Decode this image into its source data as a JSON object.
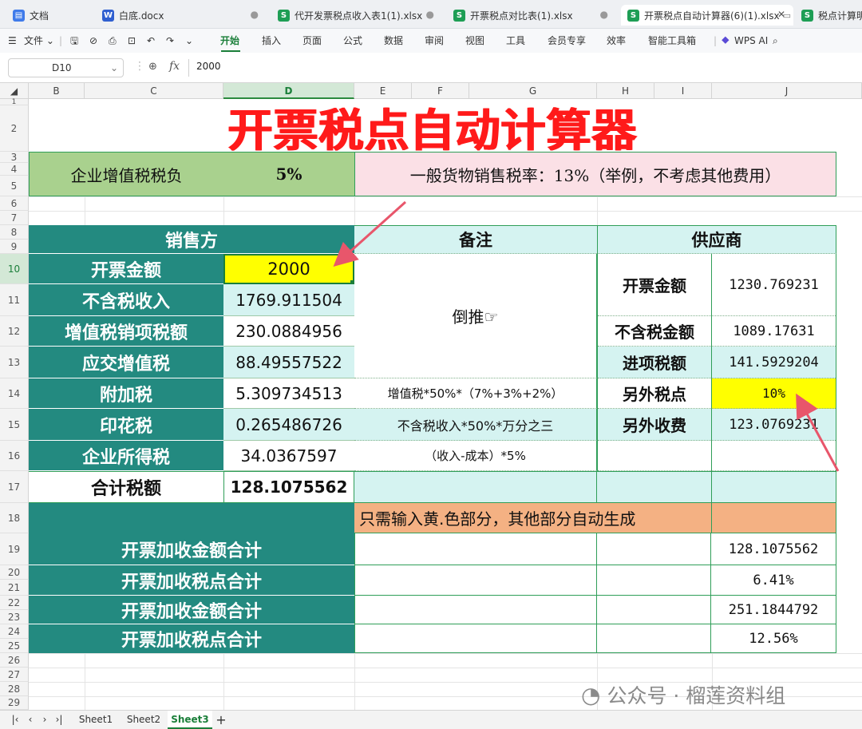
{
  "tabs": [
    {
      "label": "文档",
      "icon": "doc-home-icon",
      "badge": ""
    },
    {
      "label": "白底.docx",
      "icon": "word-icon",
      "badge": "W"
    },
    {
      "label": "代开发票税点收入表1(1).xlsx",
      "icon": "sheet-icon",
      "badge": "S"
    },
    {
      "label": "开票税点对比表(1).xlsx",
      "icon": "sheet-icon",
      "badge": "S"
    },
    {
      "label": "开票税点自动计算器(6)(1).xlsx",
      "icon": "sheet-icon",
      "badge": "S"
    },
    {
      "label": "税点计算明细",
      "icon": "sheet-icon",
      "badge": "S"
    }
  ],
  "menu": {
    "file": "文件",
    "items": [
      "开始",
      "插入",
      "页面",
      "公式",
      "数据",
      "审阅",
      "视图",
      "工具",
      "会员专享",
      "效率",
      "智能工具箱"
    ],
    "active": "开始",
    "wps_ai": "WPS AI"
  },
  "formula_bar": {
    "cell_ref": "D10",
    "fx": "fx",
    "content": "2000"
  },
  "columns": [
    "B",
    "C",
    "D",
    "E",
    "F",
    "G",
    "H",
    "I",
    "J"
  ],
  "selected_column": "D",
  "rows": [
    "1",
    "2",
    "3",
    "4",
    "5",
    "6",
    "7",
    "8",
    "9",
    "10",
    "11",
    "12",
    "13",
    "14",
    "15",
    "16",
    "17",
    "18",
    "19",
    "20",
    "21",
    "22",
    "23",
    "24",
    "25",
    "26",
    "27",
    "28",
    "29"
  ],
  "sheet": {
    "title": "开票税点自动计算器",
    "burden_label": "企业增值税税负",
    "burden_value": "5%",
    "rate_note": "一般货物销售税率：13%（举例，不考虑其他费用）",
    "seller_header": "销售方",
    "remark_header": "备注",
    "supplier_header": "供应商",
    "seller_rows": [
      {
        "label": "开票金额",
        "value": "2000"
      },
      {
        "label": "不含税收入",
        "value": "1769.911504"
      },
      {
        "label": "增值税销项税额",
        "value": "230.0884956"
      },
      {
        "label": "应交增值税",
        "value": "88.49557522"
      },
      {
        "label": "附加税",
        "value": "5.309734513"
      },
      {
        "label": "印花税",
        "value": "0.265486726"
      },
      {
        "label": "企业所得税",
        "value": "34.0367597"
      }
    ],
    "total_label": "合计税额",
    "total_value": "128.1075562",
    "remark_reverse": "倒推☞",
    "remark_surtax": "增值税*50%*（7%+3%+2%）",
    "remark_stamp": "不含税收入*50%*万分之三",
    "remark_income": "（收入-成本）*5%",
    "supplier_rows": [
      {
        "label": "开票金额",
        "value": "1230.769231"
      },
      {
        "label": "不含税金额",
        "value": "1089.17631"
      },
      {
        "label": "进项税额",
        "value": "141.5929204"
      },
      {
        "label": "另外税点",
        "value": "10%"
      },
      {
        "label": "另外收费",
        "value": "123.0769231"
      }
    ],
    "input_note": "只需输入黄.色部分，其他部分自动生成",
    "summary_rows": [
      {
        "label": "开票加收金额合计",
        "value": "128.1075562"
      },
      {
        "label": "开票加收税点合计",
        "value": "6.41%"
      },
      {
        "label": "开票加收金额合计",
        "value": "251.1844792"
      },
      {
        "label": "开票加收税点合计",
        "value": "12.56%"
      }
    ]
  },
  "watermark": "公众号 · 榴莲资料组",
  "sheet_tabs": [
    "Sheet1",
    "Sheet2",
    "Sheet3"
  ],
  "active_sheet": "Sheet3",
  "colors": {
    "teal": "#238a80",
    "light_cyan": "#d5f3f1",
    "light_green": "#a9d18e",
    "pink": "#fbe0e6",
    "yellow": "#ffff00",
    "orange": "#f4b183",
    "title_red": "#ff1a1a",
    "accent_green": "#1b7f3a"
  }
}
